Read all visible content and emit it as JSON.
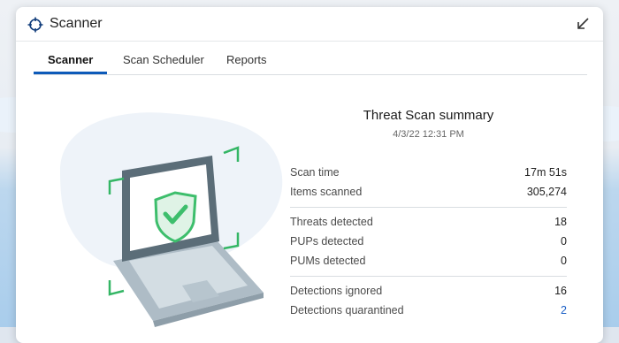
{
  "window": {
    "title": "Scanner"
  },
  "tabs": [
    {
      "label": "Scanner",
      "active": true
    },
    {
      "label": "Scan Scheduler",
      "active": false
    },
    {
      "label": "Reports",
      "active": false
    }
  ],
  "summary": {
    "title": "Threat Scan summary",
    "date": "4/3/22 12:31 PM",
    "rows": [
      {
        "label": "Scan time",
        "value": "17m 51s"
      },
      {
        "label": "Items scanned",
        "value": "305,274"
      },
      {
        "label": "Threats detected",
        "value": "18"
      },
      {
        "label": "PUPs detected",
        "value": "0"
      },
      {
        "label": "PUMs detected",
        "value": "0"
      },
      {
        "label": "Detections ignored",
        "value": "16"
      },
      {
        "label": "Detections quarantined",
        "value": "2"
      }
    ]
  },
  "icons": {
    "app": "crosshair-icon",
    "restore": "restore-arrow-icon",
    "illustration": "laptop-shield-check-icon"
  },
  "colors": {
    "accent": "#0d5ab9",
    "link": "#1a5fc6",
    "shield_green": "#3dbe6c",
    "frame_green": "#34b665"
  }
}
